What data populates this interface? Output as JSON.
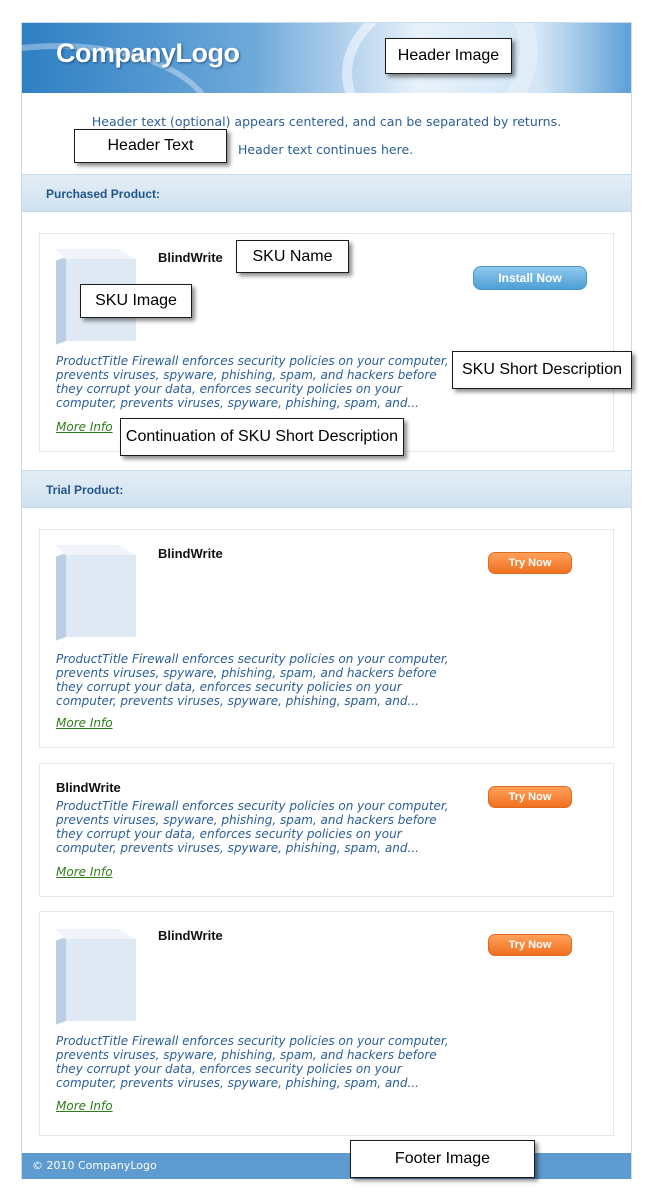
{
  "header": {
    "logo": "CompanyLogo",
    "text_line1": "Header text (optional) appears centered, and can be separated by returns.",
    "text_line2": "Header text continues here."
  },
  "sections": {
    "purchased": "Purchased Product:",
    "trial": "Trial Product:"
  },
  "purchased_product": {
    "name": "BlindWrite",
    "button": "Install Now",
    "desc": [
      "ProductTitle Firewall enforces security policies on your computer,",
      "prevents viruses, spyware, phishing, spam, and hackers before",
      "they corrupt your data, enforces security policies on your",
      "computer, prevents viruses, spyware, phishing, spam, and..."
    ],
    "more": "More Info"
  },
  "trial_products": [
    {
      "name": "BlindWrite",
      "button": "Try Now",
      "desc": [
        "ProductTitle Firewall enforces security policies on your computer,",
        "prevents viruses, spyware, phishing, spam, and hackers before",
        "they corrupt your data, enforces security policies on your",
        "computer, prevents viruses, spyware, phishing, spam, and..."
      ],
      "more": "More Info"
    },
    {
      "name": "BlindWrite",
      "button": "Try Now",
      "desc": [
        "ProductTitle Firewall enforces security policies on your computer,",
        "prevents viruses, spyware, phishing, spam, and hackers before",
        "they corrupt your data, enforces security policies on your",
        "computer, prevents viruses, spyware, phishing, spam, and..."
      ],
      "more": "More Info"
    },
    {
      "name": "BlindWrite",
      "button": "Try Now",
      "desc": [
        "ProductTitle Firewall enforces security policies on your computer,",
        "prevents viruses, spyware, phishing, spam, and hackers before",
        "they corrupt your data, enforces security policies on your",
        "computer, prevents viruses, spyware, phishing, spam, and..."
      ],
      "more": "More Info"
    }
  ],
  "footer": {
    "text": "© 2010 CompanyLogo"
  },
  "callouts": {
    "header_image": "Header Image",
    "header_text": "Header Text",
    "sku_name": "SKU Name",
    "sku_image": "SKU Image",
    "sku_short_description": "SKU Short Description",
    "continuation": "Continuation of SKU Short Description",
    "footer_image": "Footer Image"
  },
  "colors": {
    "link_blue": "#2a5f96",
    "more_info_green": "#2e7d1a",
    "install_button": "#4d9fd6",
    "try_button": "#f0701f",
    "footer_bar": "#5d9bd0"
  }
}
